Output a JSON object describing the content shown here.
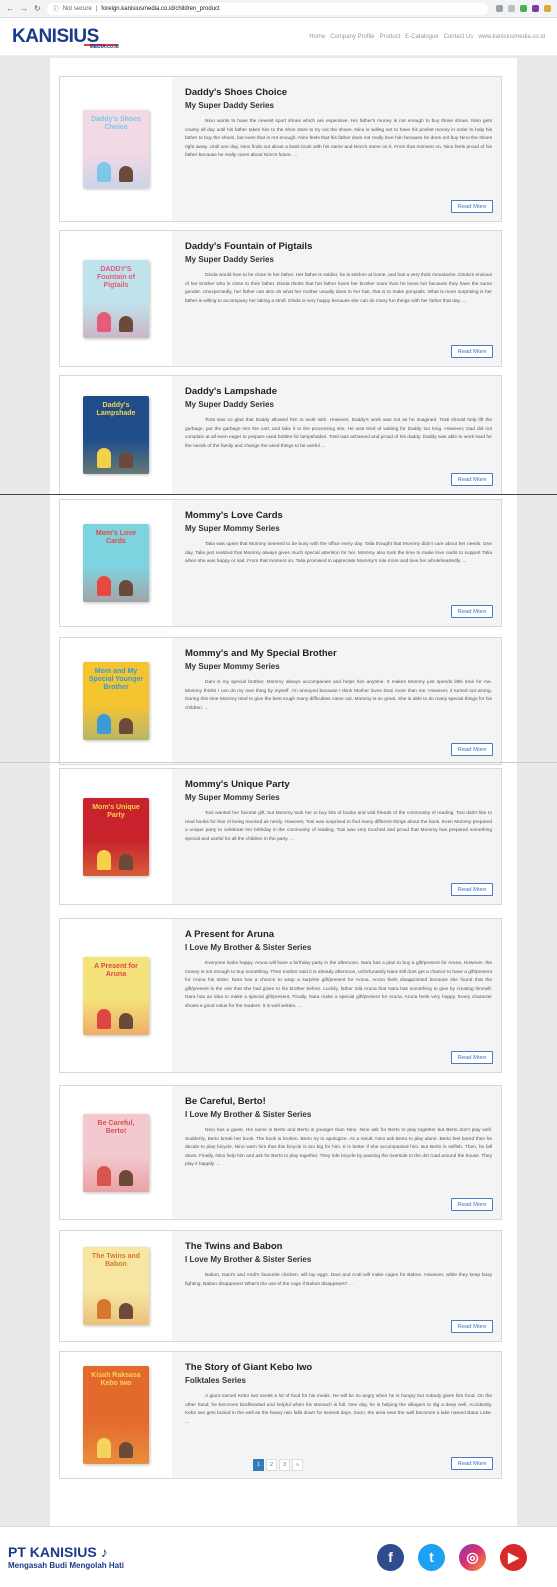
{
  "browser": {
    "security": "Not secure",
    "url": "foreign.kanisiusmedia.co.id/children_product"
  },
  "header": {
    "logo_main": "KANISIUS",
    "logo_sub": "MEDIA.co.id",
    "nav": [
      "Home",
      "Company Profile",
      "Product",
      "E-Catalogue",
      "Contact Us",
      "www.kanisiusmedia.co.id"
    ]
  },
  "books": [
    {
      "title": "Daddy's Shoes Choice",
      "series": "My Super Daddy Series",
      "description": "Nino wants to have the newest sport shoes which are expensive. His father's money is not enough to buy those shoes. Nino gets cranky all day until his father takes him to the shoe store to try out the shoes. Nino is willing not to have his pocket money in order to help his father to buy the shoes, but even that is not enough. Nino feels that his father does not really love him because he does not buy Nino the shoes right away. Until one day, Nino finds out about a bank book with his name and Nino's name on it. From that moment on, Nino feels proud of his father because he really cares about Nino's future. ...",
      "button": "Read More",
      "cover_title": "Daddy's Shoes Choice",
      "cover_color": "#f2d9e6",
      "accent": "#7fc6e8"
    },
    {
      "title": "Daddy's Fountain of Pigtails",
      "series": "My Super Daddy Series",
      "description": "Dinda would love to be close to her father. Her father is soldier, he is seldom at home, and has a very thick moustache. Dinda's envious of her brother who is close to their father. Dinda thinks that her father loves her brother more than he loves her because they have the same gender. Unexpectedly, her father can also do what her mother usually does to her hair, that is to make ponytails. What is more surprising is her father is willing to accompany her taking a stroll. Dinda is very happy because she can do many fun things with her father that day. ...",
      "button": "Read More",
      "cover_title": "DADDY'S Fountain of Pigtails",
      "cover_color": "#bfe3ec",
      "accent": "#e35c79"
    },
    {
      "title": "Daddy's Lampshade",
      "series": "My Super Daddy Series",
      "description": "Tosti was so glad that Daddy allowed him to work with. However, Daddy's work was not as he imagined. Tosti should help lift the garbage, put the garbage into the cart, and take it to the processing site. He was tired of waiting for Daddy too long. However, Dad did not complain at all even eager to prepare used bottles for lampshades. Tosti was ashamed and proud of his daddy. Daddy was able to work hard for the needs of the family and change the used things to be useful ...",
      "button": "Read More",
      "cover_title": "Daddy's Lampshade",
      "cover_color": "#1f4d8c",
      "accent": "#f3d24a"
    },
    {
      "title": "Mommy's Love Cards",
      "series": "My Super Mommy Series",
      "description": "Talia was upset that Mommy seemed to be busy with the office every day. Talia thought that Mommy didn't care about her needs. One day, Talia just realized that Mommy always gives much special attention for her. Mommy also took the time to make love cards to support Talia when she was happy or sad. From that moment on, Talia promised to appreciate Mommy's role more and love her wholeheartedly. ...",
      "button": "Read More",
      "cover_title": "Mom's Love Cards",
      "cover_color": "#7ed3e0",
      "accent": "#e8473b"
    },
    {
      "title": "Mommy's and My Special Brother",
      "series": "My Super Mommy Series",
      "description": "Dani is my special brother. Mommy always accompanies and helps him anytime. It makes Mommy just spends little time for me. Mommy thinks I can do my own thing by myself. I'm annoyed because I think Mother loves Dani more than me. However, it turned out wrong. During this time Mommy tried to give the best tough many difficulties came out. Mommy is so great. She is able to do many special things for his children. ...",
      "button": "Read More",
      "cover_title": "Mom and My Special Younger Brother",
      "cover_color": "#f5c431",
      "accent": "#3a9bd6"
    },
    {
      "title": "Mommy's Unique Party",
      "series": "My Super Mommy Series",
      "description": "Tosi wanted her favorite gift, but Mommy took her to buy lots of books and visit friends of the community of reading. Tosi didn't like to read books for fear of being mocked as nerdy. However, Tosi was surprised to find many different things about the book. Even Mommy prepared a unique party to celebrate her birthday in the community of reading. Tosi was very touched and proud that Mommy has prepared something special and useful for all the children in the party. ...",
      "button": "Read More",
      "cover_title": "Mom's Unique Party",
      "cover_color": "#c8232c",
      "accent": "#f6d04d"
    },
    {
      "title": "A Present for Aruna",
      "series": "I Love My Brother & Sister Series",
      "description": "Everyone looks happy. Aruna will have a birthday party in the afternoon. Nara has a plan to buy a gift/present for Aruna. However, the money is not enough to buy something. Then mother said it is already afternoon, unfortunately Nara still dont get a chance to have a gift/present for Aruna his sister. Nara has a chance to wrap a surprise gift/present for Aruna. Aruna feels disappointed because she found that the gift/present is the one that she had given to his brother before. Luckily, father told Aruna that Nara has something to give by creating himself. Nara has an idea to make a special gift/present. Finally, Nara make a special gift/present for Aruna. Aruna feels very happy. Every character shows a good value for the readers. It is well written. ...",
      "button": "Read More",
      "cover_title": "A Present for Aruna",
      "cover_color": "#f4e27a",
      "accent": "#e04545"
    },
    {
      "title": "Be Careful, Berto!",
      "series": "I Love My Brother & Sister Series",
      "description": "Nino has a guest. His name is Berto and Berto is younger than Nino. Nino ask for Berto to play together but Berto don't play well. Suddenly, Berto break her book. The book is broken. Berto try to apologize. As a result, Nino ask Berto to play alone. Berto feel bored then he decide to play bicycle. Nino warn him that this bicycle is too big for him. It is better if she accompanied him. But Berto is selfish. Then, he fall down. Finally, Nino help him and ask for Berto to play together. They ride bicycle by passing the riverside to the dirt road around the house. They play it happily. ...",
      "button": "Read More",
      "cover_title": "Be Careful, Berto!",
      "cover_color": "#f3c9cf",
      "accent": "#d9534f"
    },
    {
      "title": "The Twins and Babon",
      "series": "I Love My Brother & Sister Series",
      "description": "Babon, Dani's and Andi's favourite chicken, will lay eggs. Dani and Andi will make cages for Babon. However, while they keep busy fighting, Babon disappears! What's the use of the cage if Babon disappears? ...",
      "button": "Read More",
      "cover_title": "The Twins and Babon",
      "cover_color": "#f7e6a2",
      "accent": "#d6772f"
    },
    {
      "title": "The Story of Giant Kebo Iwo",
      "series": "Folktales Series",
      "description": "A giant named Kebo Iwo needs a lot of food for his meals. He will be so angry when he is hungry but nobody gives him food. On the other hand, he becomes kindhearted and helpful when his stomach is full. One day, he is helping the villagers to dig a deep well. Accidently, Kebo Iwo gets buried in the well as the heavy rain falls down for several days. Soon, the area near the well becomes a lake named Batur Lake. ...",
      "button": "Read More",
      "cover_title": "Kisah Raksasa Kebo Iwo",
      "cover_color": "#e36a2c",
      "accent": "#f4d35e"
    }
  ],
  "pagination": [
    "1",
    "2",
    "3",
    "»"
  ],
  "footer": {
    "brand": "PT KANISIUS",
    "tagline": "Mengasah Budi Mengolah Hati",
    "socials": [
      {
        "name": "facebook-icon",
        "glyph": "f"
      },
      {
        "name": "twitter-icon",
        "glyph": "t"
      },
      {
        "name": "instagram-icon",
        "glyph": "◎"
      },
      {
        "name": "youtube-icon",
        "glyph": "▶"
      }
    ]
  }
}
